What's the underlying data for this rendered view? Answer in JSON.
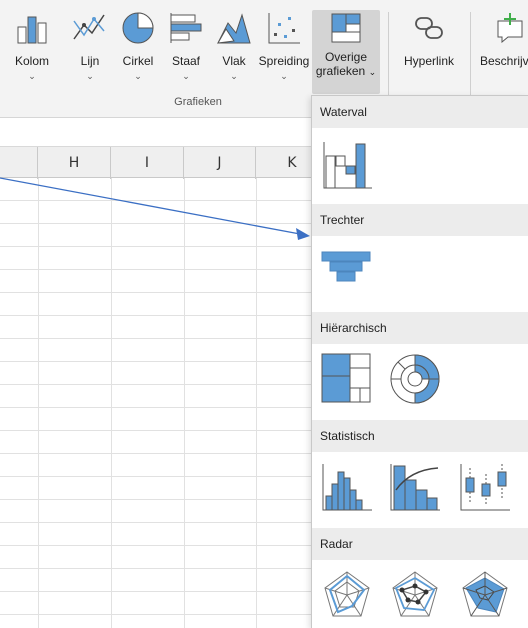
{
  "ribbon": {
    "buttons": [
      {
        "id": "kolom",
        "label": "Kolom",
        "icon": "column-chart-icon"
      },
      {
        "id": "lijn",
        "label": "Lijn",
        "icon": "line-chart-icon"
      },
      {
        "id": "cirkel",
        "label": "Cirkel",
        "icon": "pie-chart-icon"
      },
      {
        "id": "staaf",
        "label": "Staaf",
        "icon": "bar-chart-icon"
      },
      {
        "id": "vlak",
        "label": "Vlak",
        "icon": "area-chart-icon"
      },
      {
        "id": "spreiding",
        "label": "Spreiding",
        "icon": "scatter-chart-icon"
      }
    ],
    "other_charts_line1": "Overige",
    "other_charts_line2": "grafieken",
    "hyperlink_label": "Hyperlink",
    "describe_label": "Beschrijv",
    "group_label": "Grafieken",
    "chevron": "⌄",
    "accent": "#5b9bd5"
  },
  "sheet": {
    "columns": [
      "H",
      "I",
      "J",
      "K"
    ]
  },
  "dropdown": {
    "sections": [
      {
        "title": "Waterval",
        "charts": [
          "waterfall-chart-icon"
        ]
      },
      {
        "title": "Trechter",
        "charts": [
          "funnel-chart-icon"
        ]
      },
      {
        "title": "Hiërarchisch",
        "charts": [
          "treemap-chart-icon",
          "sunburst-chart-icon"
        ]
      },
      {
        "title": "Statistisch",
        "charts": [
          "histogram-chart-icon",
          "pareto-chart-icon",
          "box-whisker-chart-icon"
        ]
      },
      {
        "title": "Radar",
        "charts": [
          "radar-chart-icon",
          "radar-markers-chart-icon",
          "filled-radar-chart-icon"
        ]
      }
    ]
  },
  "annotation": {
    "arrow_color": "#3b6fc4"
  }
}
